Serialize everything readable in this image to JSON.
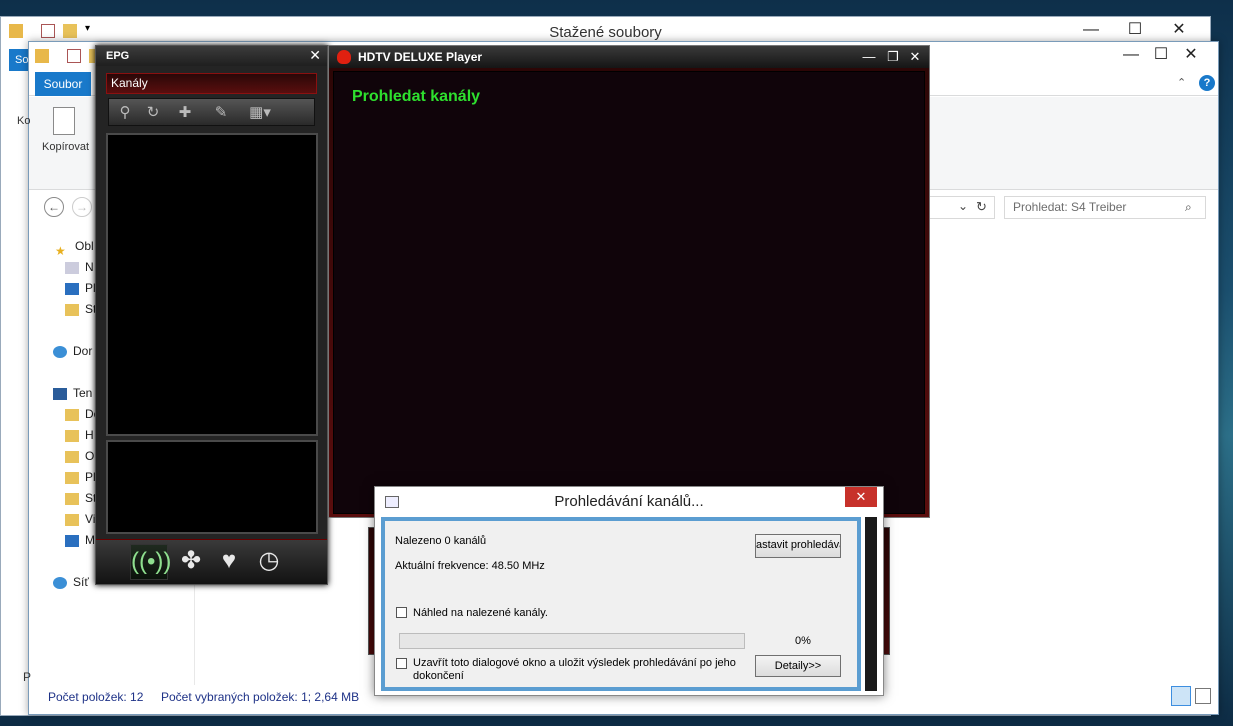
{
  "explorer_back": {
    "title": "Stažené soubory",
    "tab_label": "So",
    "minimize": "—",
    "maximize": "☐",
    "close": "✕"
  },
  "explorer_front": {
    "minimize": "—",
    "maximize": "☐",
    "close": "✕",
    "file_tab": "Soubor",
    "ribbon_left_text": "Ko",
    "copy_label": "Kopírovat",
    "search_placeholder": "Prohledat: S4 Treiber",
    "nav_items": [
      "Obl",
      "N",
      "Pl",
      "St",
      "Dor",
      "Ten",
      "Do",
      "H",
      "O",
      "Pl",
      "St",
      "Vi",
      "M",
      "Síť"
    ],
    "status_left": "P",
    "status_count": "Počet položek: 12",
    "status_selected": "Počet vybraných položek: 1; 2,64 MB"
  },
  "epg": {
    "title": "EPG",
    "close": "✕",
    "channels_label": "Kanály"
  },
  "player": {
    "title": "HDTV DELUXE Player",
    "minimize": "—",
    "restore": "❐",
    "close": "✕",
    "screen_text": "Prohledat kanály"
  },
  "scan_dialog": {
    "title": "Prohledávání kanálů...",
    "close": "✕",
    "found": "Nalezeno 0 kanálů",
    "frequency": "Aktuální frekvence: 48.50 MHz",
    "stop_button": "astavit prohledává",
    "preview_label": "Náhled na nalezené kanály.",
    "progress_value": 0,
    "progress_text": "0%",
    "close_save_label": "Uzavřít toto dialogové okno a uložit výsledek prohledávání po jeho dokončení",
    "details_button": "Detaily>>"
  }
}
